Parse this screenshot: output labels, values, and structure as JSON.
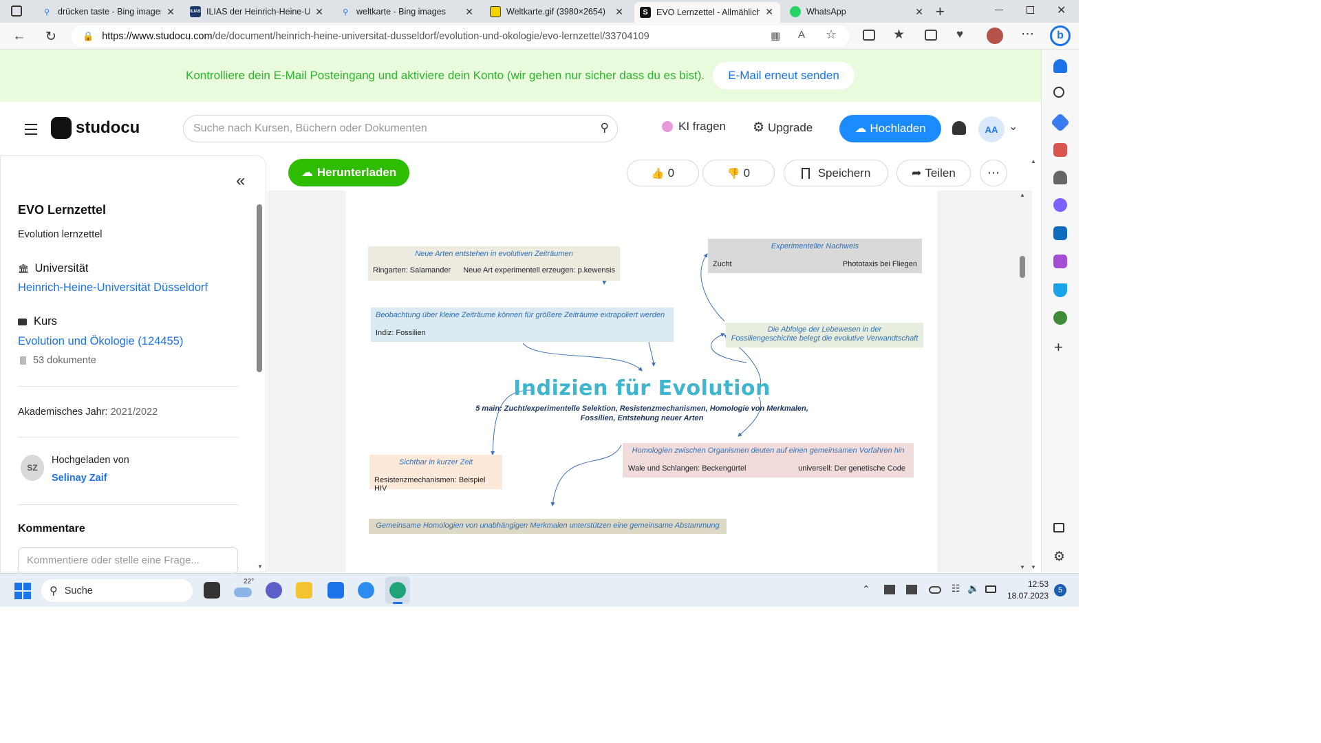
{
  "browser": {
    "tabs": [
      {
        "title": "drücken taste - Bing images",
        "icon": "search-icon"
      },
      {
        "title": "ILIAS der Heinrich-Heine-Ur",
        "icon": "ilias-icon"
      },
      {
        "title": "weltkarte - Bing images",
        "icon": "search-icon"
      },
      {
        "title": "Weltkarte.gif (3980×2654)",
        "icon": "image-icon"
      },
      {
        "title": "EVO Lernzettel - Allmählich",
        "icon": "studocu-icon"
      },
      {
        "title": "WhatsApp",
        "icon": "whatsapp-icon"
      }
    ],
    "url_host": "https://www.studocu.com",
    "url_path": "/de/document/heinrich-heine-universitat-dusseldorf/evolution-und-okologie/evo-lernzettel/33704109"
  },
  "banner": {
    "message": "Kontrolliere dein E-Mail Posteingang und aktiviere dein Konto (wir gehen nur sicher dass du es bist).",
    "resend_label": "E-Mail erneut senden"
  },
  "header": {
    "logo": "studocu",
    "search_placeholder": "Suche nach Kursen, Büchern oder Dokumenten",
    "ask_ai": "KI fragen",
    "upgrade": "Upgrade",
    "upload": "Hochladen",
    "avatar": "AA"
  },
  "sidebar": {
    "title": "EVO Lernzettel",
    "subtitle": "Evolution lernzettel",
    "university_label": "Universität",
    "university": "Heinrich-Heine-Universität Düsseldorf",
    "course_label": "Kurs",
    "course": "Evolution und Ökologie (124455)",
    "doc_count": "53 dokumente",
    "year_label": "Akademisches Jahr:",
    "year": "2021/2022",
    "uploaded_by_label": "Hochgeladen von",
    "uploader": "Selinay Zaif",
    "uploader_initials": "SZ",
    "comments_title": "Kommentare",
    "comment_placeholder": "Kommentiere oder stelle eine Frage..."
  },
  "toolbar": {
    "download": "Herunterladen",
    "likes": "0",
    "dislikes": "0",
    "save": "Speichern",
    "share": "Teilen"
  },
  "document": {
    "title": "Indizien für Evolution",
    "subtitle_line1": "5 main: Zucht/experimentelle Selektion, Resistenzmechanismen, Homologie von Merkmalen,",
    "subtitle_line2": "Fossilien, Entstehung neuer Arten",
    "boxes": {
      "neue_arten": {
        "heading": "Neue Arten entstehen in evolutiven Zeiträumen",
        "left": "Ringarten: Salamander",
        "right": "Neue Art experimentell erzeugen: p.kewensis"
      },
      "experimentell": {
        "heading": "Experimenteller Nachweis",
        "left": "Zucht",
        "right": "Phototaxis bei Fliegen"
      },
      "beobachtung": {
        "heading": "Beobachtung über kleine Zeiträume können für größere Zeiträume extrapoliert werden",
        "left": "Indiz: Fossilien"
      },
      "abfolge": {
        "heading1": "Die Abfolge der Lebewesen in der",
        "heading2": "Fossiliengeschichte belegt die evolutive Verwandtschaft"
      },
      "sichtbar": {
        "heading": "Sichtbar in kurzer Zeit",
        "left": "Resistenzmechanismen: Beispiel HIV"
      },
      "homologien": {
        "heading": "Homologien zwischen Organismen deuten auf einen gemeinsamen Vorfahren hin",
        "left": "Wale und Schlangen: Beckengürtel",
        "right": "universell: Der genetische Code"
      },
      "gemeinsame": {
        "heading": "Gemeinsame Homologien von unabhängigen Merkmalen unterstützen eine gemeinsame Abstammung"
      }
    }
  },
  "taskbar": {
    "search": "Suche",
    "weather": "22°",
    "time": "12:53",
    "date": "18.07.2023",
    "notifications": "5"
  },
  "colors": {
    "studocu_blue": "#1a8cff",
    "download_green": "#2ebd00",
    "banner_bg": "#eafadc",
    "banner_text": "#2bb52b",
    "title_teal": "#3fb6cf"
  }
}
